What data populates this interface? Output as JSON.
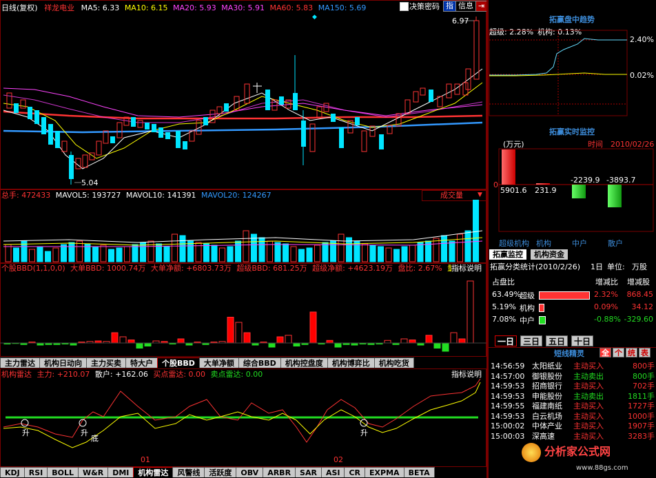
{
  "colors": {
    "ma5": "#ffffff",
    "ma10": "#ffff00",
    "ma20": "#ff44ff",
    "ma30": "#ff44ff",
    "ma60": "#ff3333",
    "ma150": "#3399ff",
    "up": "#ff3333",
    "down": "#00e5ff",
    "green": "#22dd22"
  },
  "header": {
    "period": "日线(复权)",
    "stock": "祥龙电业",
    "ma5": "MA5: 6.33",
    "ma10": "MA10: 6.15",
    "ma20": "MA20: 5.93",
    "ma30": "MA30: 5.91",
    "ma60": "MA60: 5.83",
    "ma150": "MA150: 5.69",
    "decision_label": "决策密码",
    "btn_fingers": "指",
    "btn_info": "信息",
    "btn_exit": "⇥"
  },
  "price_chart": {
    "high_label": "6.97",
    "low_label": "5.04"
  },
  "volume": {
    "total": "总手: 472433",
    "mavol5": "MAVOL5: 193727",
    "mavol10": "MAVOL10: 141391",
    "mavol20": "MAVOL20: 124267",
    "dropdown": "成交量"
  },
  "bbd": {
    "line": "个股BBD(1,1,0,0)",
    "big": "大单BBD: 1000.74万",
    "big_net": "大单净额: +6803.73万",
    "super": "超级BBD: 681.25万",
    "super_net": "超级净额: +4623.19万",
    "ratio": "盘比: 2.67%",
    "mark": "量",
    "explain": "指标说明"
  },
  "indicator_tabs": [
    "主力雷达",
    "机构日动向",
    "主力买卖",
    "特大户",
    "个股BBD",
    "大单净额",
    "综合BBD",
    "机构控盘度",
    "机构博弈比",
    "机构吃货"
  ],
  "radar": {
    "title": "机构雷达",
    "main": "主力: +210.07",
    "retail": "散户: +162.06",
    "buy": "买点雷达: 0.00",
    "sell": "卖点雷达: 0.00",
    "explain": "指标说明",
    "sig1": "升",
    "sig2": "升",
    "sig3": "底",
    "sig4": "升"
  },
  "dates": {
    "d1": "01",
    "d2": "02"
  },
  "bottom_tabs": [
    "KDJ",
    "RSI",
    "BOLL",
    "W&R",
    "DMI",
    "机构雷达",
    "风警线",
    "活跃度",
    "OBV",
    "ARBR",
    "SAR",
    "ASI",
    "CR",
    "EXPMA",
    "BETA"
  ],
  "right": {
    "trend_title": "拓赢盘中趋势",
    "trend_super": "超级: 2.28%",
    "trend_inst": "机构: 0.13%",
    "trend_y1": "2.40%",
    "trend_y2": "0.02%",
    "monitor_title": "拓赢实时监控",
    "unit": "(万元)",
    "time_label": "时间",
    "time_value": "2010/02/26",
    "zero": "0",
    "v1": "5901.6",
    "v2": "231.9",
    "v3": "-2239.9",
    "v4": "-3893.7",
    "cat1": "超级机构",
    "cat2": "机构",
    "cat3": "中户",
    "cat4": "散户",
    "tab_monitor": "拓赢监控",
    "tab_fund": "机构资金",
    "stat_title": "拓赢分类统计(2010/2/26)",
    "stat_period": "1日",
    "stat_unit_label": "单位:",
    "stat_unit": "万股",
    "head_share": "占盘比",
    "head_ratio": "增减比",
    "head_amount": "增减股",
    "stats": [
      {
        "pct": "63.49%",
        "name": "超级",
        "ratio": "2.32%",
        "amount": "868.45"
      },
      {
        "pct": "5.19%",
        "name": "机构",
        "ratio": "0.09%",
        "amount": "34.12"
      },
      {
        "pct": "7.08%",
        "name": "中户",
        "ratio": "-0.88%",
        "amount": "-329.60"
      }
    ],
    "periods": [
      "一日",
      "三日",
      "五日",
      "十日"
    ],
    "sprite_title": "短线精灵",
    "sprite_btns": [
      "全",
      "个",
      "统",
      "表"
    ],
    "ticks": [
      {
        "time": "14:56:59",
        "name": "太阳纸业",
        "action": "主动买入",
        "vol": "800手"
      },
      {
        "time": "14:57:00",
        "name": "御银股份",
        "action": "主动卖出",
        "vol": "800手"
      },
      {
        "time": "14:59:53",
        "name": "招商银行",
        "action": "主动买入",
        "vol": "702手"
      },
      {
        "time": "14:59:53",
        "name": "申能股份",
        "action": "主动卖出",
        "vol": "1811手"
      },
      {
        "time": "14:59:55",
        "name": "福建南纸",
        "action": "主动买入",
        "vol": "1727手"
      },
      {
        "time": "14:59:53",
        "name": "白云机场",
        "action": "主动买入",
        "vol": "1000手"
      },
      {
        "time": "15:00:02",
        "name": "中体产业",
        "action": "主动买入",
        "vol": "1907手"
      },
      {
        "time": "15:00:03",
        "name": "深高速",
        "action": "主动买入",
        "vol": "3283手"
      }
    ],
    "watermark": "分析家公式网",
    "watermark_url": "www.88gs.com"
  }
}
